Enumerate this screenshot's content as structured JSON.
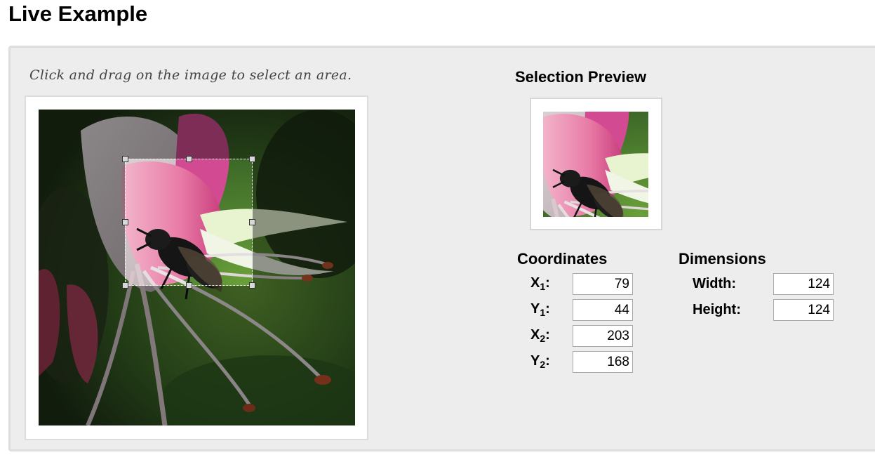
{
  "page": {
    "title": "Live Example",
    "instruction": "Click and drag on the image to select an area."
  },
  "preview": {
    "heading": "Selection Preview"
  },
  "coordinates": {
    "heading": "Coordinates",
    "x1_label": "X",
    "x1_sub": "1",
    "x1_value": "79",
    "y1_label": "Y",
    "y1_sub": "1",
    "y1_value": "44",
    "x2_label": "X",
    "x2_sub": "2",
    "x2_value": "203",
    "y2_label": "Y",
    "y2_sub": "2",
    "y2_value": "168"
  },
  "dimensions": {
    "heading": "Dimensions",
    "width_label": "Width:",
    "width_value": "124",
    "height_label": "Height:",
    "height_value": "124"
  },
  "colors": {
    "panel_background": "#ededed",
    "panel_border": "#dddddd",
    "frame_background": "#ffffff",
    "flower_pink": "#e0609a",
    "leaf_green": "#4f8a2e"
  },
  "icons": {
    "selection_handle": "square-handle-icon"
  }
}
